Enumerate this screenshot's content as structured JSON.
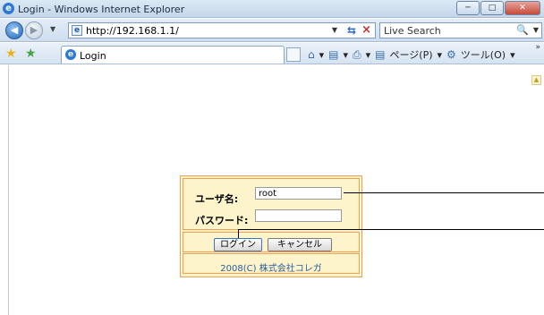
{
  "window": {
    "title": "Login - Windows Internet Explorer",
    "controls": [
      "minimize",
      "maximize",
      "close"
    ]
  },
  "nav": {
    "url": "http://192.168.1.1/",
    "search_placeholder": "Live Search"
  },
  "favbar": {
    "tab_label": "Login",
    "page_menu": "ページ(P)",
    "tools_menu": "ツール(O)"
  },
  "login": {
    "username_label": "ユーザ名:",
    "username_value": "root",
    "password_label": "パスワード:",
    "password_value": "",
    "login_button": "ログイン",
    "cancel_button": "キャンセル",
    "copyright": "2008(C) 株式会社コレガ"
  },
  "colors": {
    "panel_bg": "#fdf4cc",
    "panel_border": "#f0a050",
    "copyright_text": "#2a5d9a"
  }
}
